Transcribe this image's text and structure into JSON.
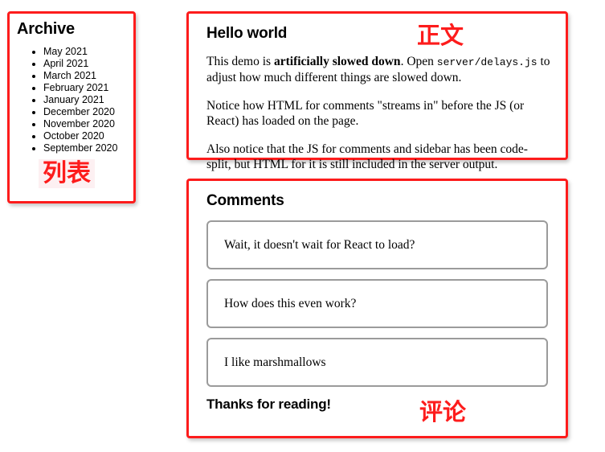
{
  "colors": {
    "annotation_red": "#fd1c1c",
    "panel_border": "#fd1c1c",
    "comment_box_border": "#9b9b9b",
    "page_background": "#ffffff",
    "text": "#000000",
    "annotation_list_background": "#fdf0f2"
  },
  "sidebar": {
    "title": "Archive",
    "items": [
      "May 2021",
      "April 2021",
      "March 2021",
      "February 2021",
      "January 2021",
      "December 2020",
      "November 2020",
      "October 2020",
      "September 2020"
    ]
  },
  "post": {
    "title": "Hello world",
    "paragraph1": {
      "lead": "This demo is ",
      "bold": "artificially slowed down",
      "mid": ". Open ",
      "code": "server/delays.js",
      "tail": " to adjust how much different things are slowed down."
    },
    "paragraph2": "Notice how HTML for comments \"streams in\" before the JS (or React) has loaded on the page.",
    "paragraph3": "Also notice that the JS for comments and sidebar has been code-split, but HTML for it is still included in the server output."
  },
  "comments": {
    "title": "Comments",
    "items": [
      "Wait, it doesn't wait for React to load?",
      "How does this even work?",
      "I like marshmallows"
    ],
    "footer": "Thanks for reading!"
  },
  "annotations": {
    "list": "列表",
    "body": "正文",
    "comments": "评论"
  }
}
